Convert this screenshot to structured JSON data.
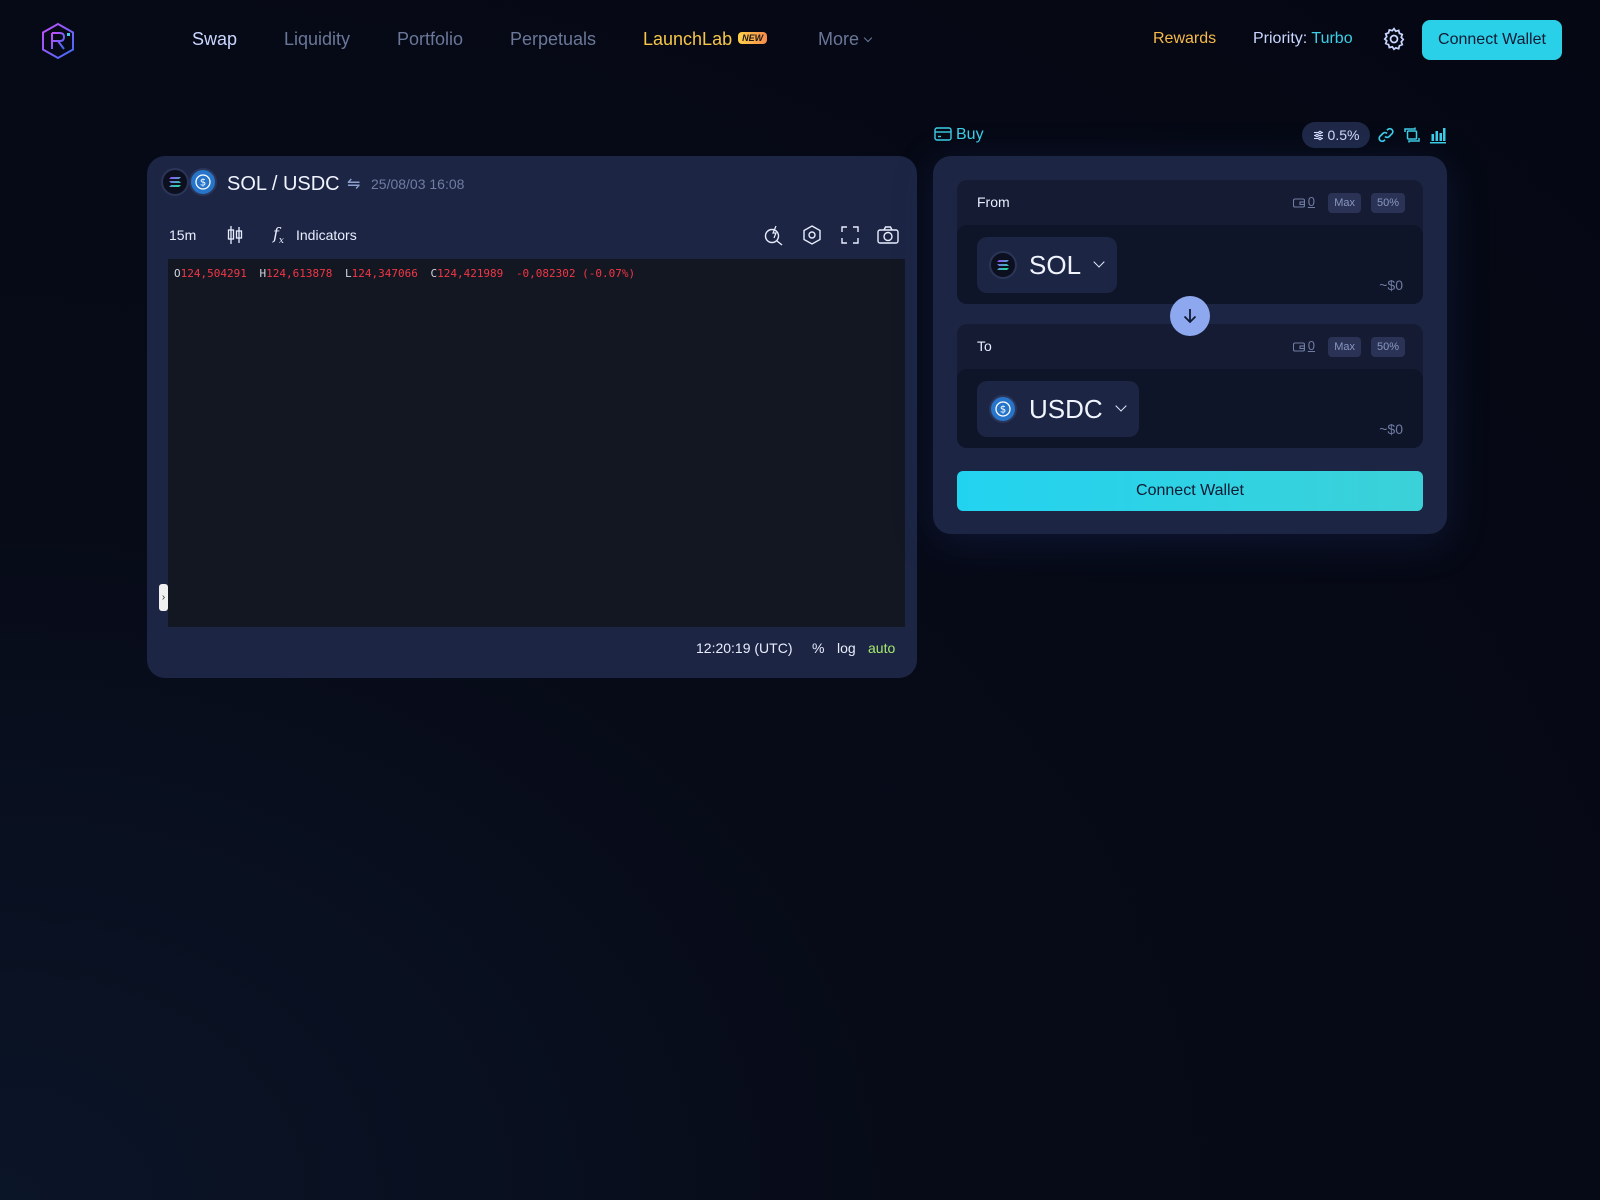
{
  "nav": {
    "links": [
      {
        "label": "Swap"
      },
      {
        "label": "Liquidity"
      },
      {
        "label": "Portfolio"
      },
      {
        "label": "Perpetuals"
      },
      {
        "label": "LaunchLab",
        "badge": "NEW"
      },
      {
        "label": "More"
      }
    ],
    "rewards": "Rewards",
    "priority_label": "Priority:",
    "priority_value": "Turbo",
    "connect_wallet": "Connect Wallet"
  },
  "chart": {
    "pair": "SOL / USDC",
    "datetime": "25/08/03 16:08",
    "interval": "15m",
    "indicators": "Indicators",
    "ohlc": {
      "o_label": "O",
      "o": "124,504291",
      "h_label": "H",
      "h": "124,613878",
      "l_label": "L",
      "l": "124,347066",
      "c_label": "C",
      "c": "124,421989",
      "change": "-0,082302 (-0.07%)"
    },
    "clock": "12:20:19 (UTC)",
    "percent": "%",
    "log": "log",
    "auto": "auto"
  },
  "swap": {
    "buy": "Buy",
    "slippage": "0.5%",
    "from": {
      "label": "From",
      "balance": "0",
      "max": "Max",
      "half": "50%",
      "token": "SOL",
      "usd": "~$0"
    },
    "to": {
      "label": "To",
      "balance": "0",
      "max": "Max",
      "half": "50%",
      "token": "USDC",
      "usd": "~$0"
    },
    "connect_wallet": "Connect Wallet"
  },
  "colors": {
    "accent": "#2ad0e8",
    "panel": "#1c2543",
    "down": "#f23645",
    "rewards": "#f6b94a"
  },
  "icons": [
    "raydium-logo-icon",
    "gear-icon",
    "card-icon",
    "sliders-icon",
    "link-icon",
    "refresh-icon",
    "bar-chart-icon",
    "wallet-icon",
    "arrow-down-icon",
    "candlestick-icon",
    "fx-icon",
    "zoom-icon",
    "hexagon-settings-icon",
    "fullscreen-icon",
    "camera-icon"
  ]
}
